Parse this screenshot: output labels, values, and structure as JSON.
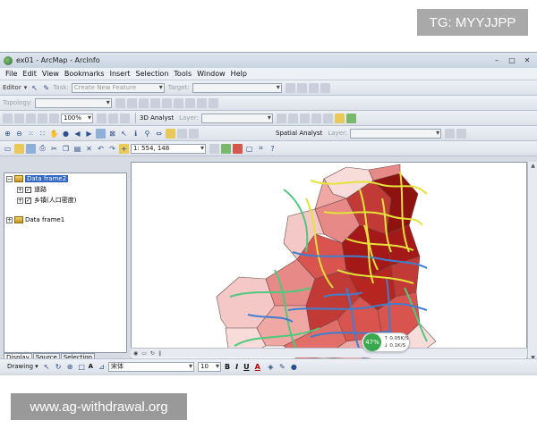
{
  "overlay": {
    "tg_badge": "TG: MYYJJPP",
    "watermark": "www.ag-withdrawal.org"
  },
  "window": {
    "title": "ex01 - ArcMap - ArcInfo"
  },
  "menu": [
    "File",
    "Edit",
    "View",
    "Bookmarks",
    "Insert",
    "Selection",
    "Tools",
    "Window",
    "Help"
  ],
  "editor_toolbar": {
    "editor_label": "Editor",
    "task_label": "Task:",
    "task_value": "Create New Feature",
    "target_label": "Target:"
  },
  "topology_toolbar": {
    "topology_label": "Topology:"
  },
  "analyst_toolbar": {
    "zoom_value": "100%",
    "analyst_3d_label": "3D Analyst",
    "layer_label": "Layer:"
  },
  "tools_toolbar": {
    "spatial_analyst_label": "Spatial Analyst",
    "layer_label": "Layer:"
  },
  "standard_toolbar": {
    "scale_value": "1: 554, 148"
  },
  "toc": {
    "frames": [
      {
        "name": "Data frame2",
        "active": true,
        "layers": [
          "道路",
          "乡镇(人口密度)"
        ]
      },
      {
        "name": "Data frame1",
        "active": false,
        "layers": []
      }
    ],
    "tabs": [
      "Display",
      "Source",
      "Selection"
    ]
  },
  "network": {
    "percent": "47%",
    "up": "0.05K/S",
    "down": "0.1K/S"
  },
  "drawing_toolbar": {
    "drawing_label": "Drawing",
    "text_tool": "A",
    "font_name": "宋体",
    "font_size": "10",
    "bold": "B",
    "italic": "I",
    "underline": "U",
    "font_color": "A"
  },
  "colors": {
    "map_dark": "#a51818",
    "map_mid": "#d9534f",
    "map_light": "#f2b6b4",
    "road_yellow": "#e6e23a",
    "road_green": "#4fc97b",
    "road_blue": "#3f7fd0"
  }
}
